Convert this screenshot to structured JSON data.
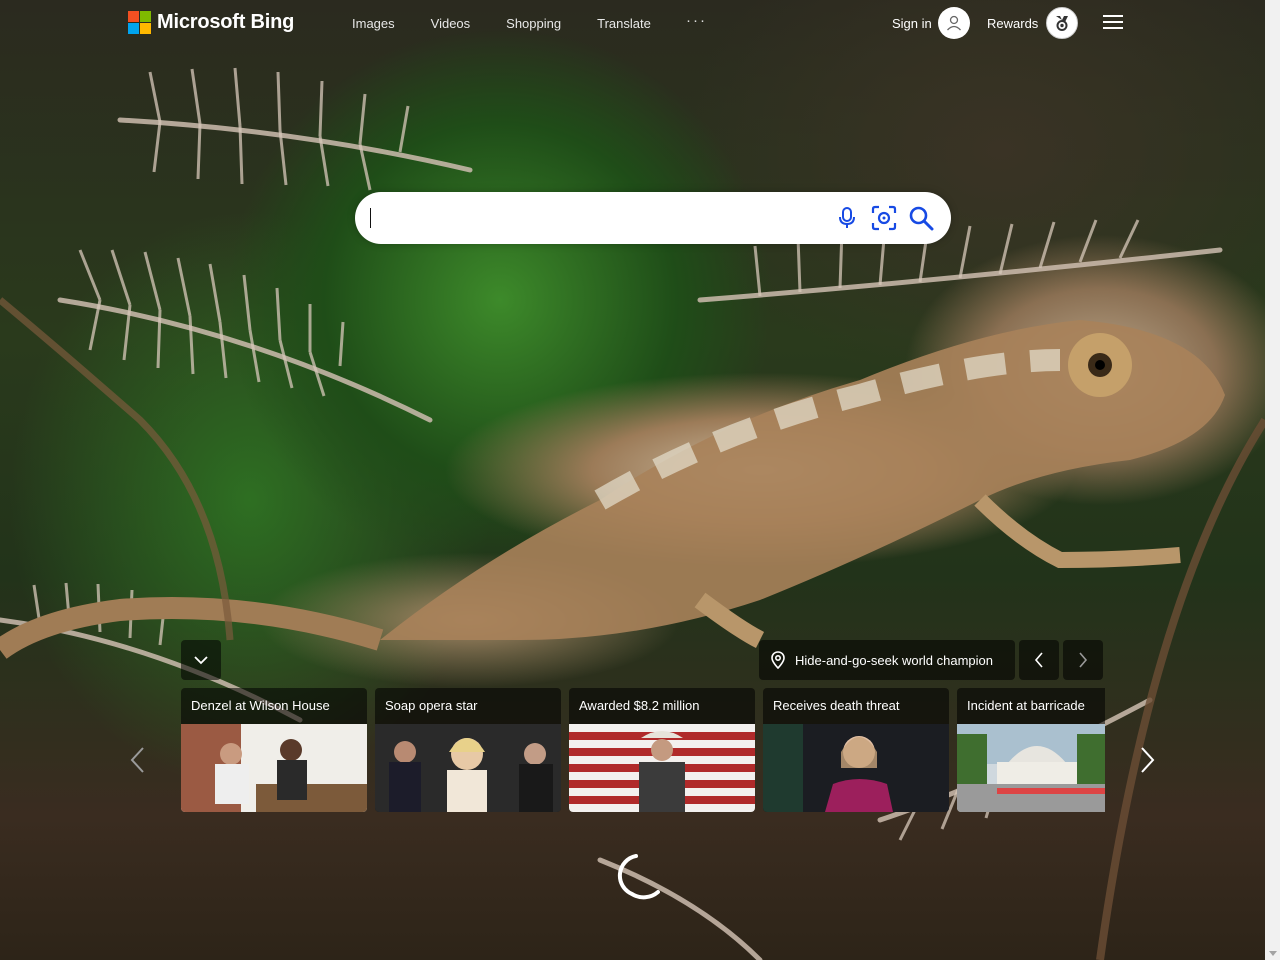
{
  "header": {
    "logo_text": "Microsoft Bing",
    "logo_colors": [
      "#f25022",
      "#7fba00",
      "#00a4ef",
      "#ffb900"
    ],
    "nav": [
      {
        "label": "Images"
      },
      {
        "label": "Videos"
      },
      {
        "label": "Shopping"
      },
      {
        "label": "Translate"
      }
    ],
    "more_label": "···",
    "signin_label": "Sign in",
    "rewards_label": "Rewards"
  },
  "search": {
    "value": "",
    "placeholder": "",
    "accent_color": "#174ae4"
  },
  "image_info": {
    "hint_text": "Hide-and-go-seek world champion"
  },
  "news_cards": [
    {
      "title": "Denzel at Wilson House"
    },
    {
      "title": "Soap opera star"
    },
    {
      "title": "Awarded $8.2 million"
    },
    {
      "title": "Receives death threat"
    },
    {
      "title": "Incident at barricade"
    }
  ],
  "icons": [
    "search-icon",
    "microphone-icon",
    "visual-search-icon",
    "user-icon",
    "rewards-medal-icon",
    "hamburger-menu-icon",
    "chevron-down-icon",
    "location-pin-icon",
    "chevron-left-icon",
    "chevron-right-icon",
    "loading-spinner-icon"
  ]
}
